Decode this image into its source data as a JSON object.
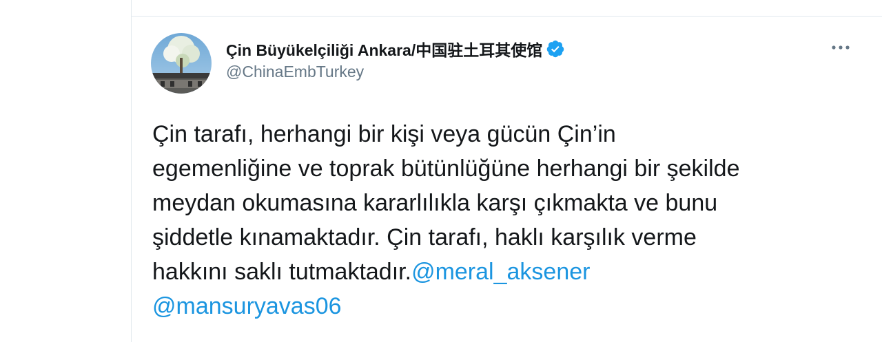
{
  "tweet": {
    "author": {
      "display_name": "Çin Büyükelçiliği Ankara/中国驻土耳其使馆",
      "handle": "@ChinaEmbTurkey",
      "verified": true
    },
    "more_icon": "more-horizontal-icon",
    "text_lines": [
      "Çin tarafı, herhangi bir kişi veya gücün Çin’in",
      "egemenliğine ve toprak bütünlüğüne herhangi bir şekilde",
      "meydan okumasına kararlılıkla karşı çıkmakta ve bunu",
      "şiddetle kınamaktadır. Çin tarafı, haklı karşılık verme",
      "hakkını saklı tutmaktadır."
    ],
    "mentions": [
      "@meral_aksener",
      "@mansuryavas06"
    ]
  },
  "colors": {
    "text": "#14171a",
    "secondary": "#657786",
    "link": "#1b95e0",
    "verified": "#1da1f2",
    "border": "#e1e8ed"
  }
}
